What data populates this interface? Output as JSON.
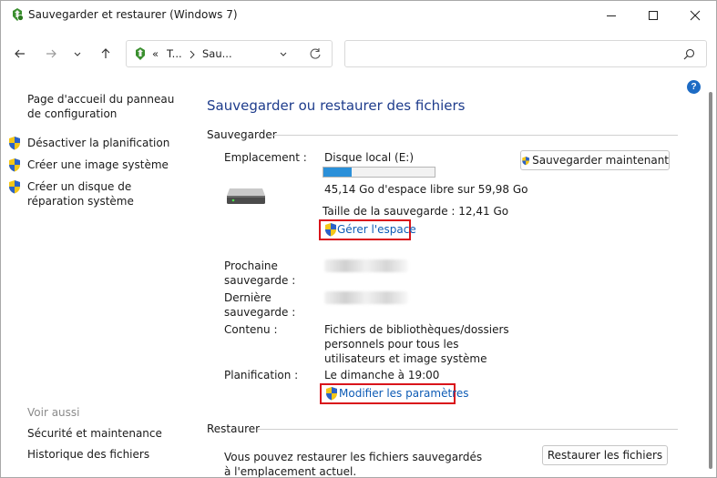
{
  "window": {
    "title": "Sauvegarder et restaurer (Windows 7)",
    "buttons": [
      "minimize",
      "maximize",
      "close"
    ]
  },
  "address": {
    "prefix": "«",
    "crumb1": "T...",
    "crumb2": "Sau...",
    "icons": [
      "control-panel-icon",
      "chevron-down-icon",
      "refresh-icon"
    ]
  },
  "search": {
    "placeholder": "",
    "icon": "search-icon"
  },
  "left_pane": {
    "home_link": "Page d'accueil du panneau de configuration",
    "tasks": [
      {
        "label": "Désactiver la planification",
        "icon": "shield-icon"
      },
      {
        "label": "Créer une image système",
        "icon": "shield-icon"
      },
      {
        "label": "Créer un disque de réparation système",
        "icon": "shield-icon"
      }
    ],
    "see_also_label": "Voir aussi",
    "see_also": [
      "Sécurité et maintenance",
      "Historique des fichiers"
    ]
  },
  "main": {
    "heading": "Sauvegarder ou restaurer des fichiers",
    "backup_section": "Sauvegarder",
    "location_label": "Emplacement :",
    "location_value": "Disque local (E:)",
    "disk_usage_fraction": 0.25,
    "free_space": "45,14 Go d'espace libre sur 59,98 Go",
    "backup_size": "Taille de la sauvegarde : 12,41 Go",
    "manage_space_link": "Gérer l'espace",
    "backup_now_button": "Sauvegarder maintenant",
    "next_backup_label": "Prochaine sauvegarde :",
    "last_backup_label": "Dernière sauvegarde :",
    "content_label": "Contenu :",
    "content_value": "Fichiers de bibliothèques/dossiers personnels pour tous les utilisateurs et image système",
    "schedule_label": "Planification :",
    "schedule_value": "Le dimanche à 19:00",
    "change_settings_link": "Modifier les paramètres",
    "restore_section": "Restaurer",
    "restore_text": "Vous pouvez restaurer les fichiers sauvegardés à l'emplacement actuel.",
    "restore_button": "Restaurer les fichiers",
    "help_label": "?"
  },
  "colors": {
    "heading": "#1e3c8c",
    "link": "#0d5bb5",
    "highlight_box": "#d9141b",
    "progress": "#2b90d9"
  }
}
